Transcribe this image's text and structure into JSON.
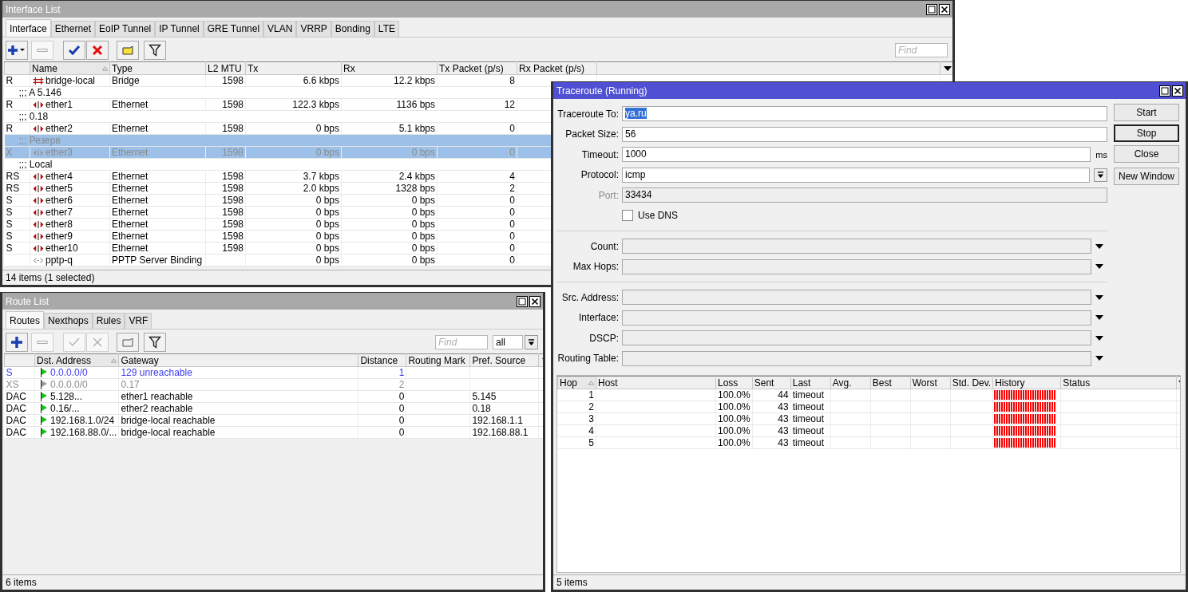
{
  "interface_window": {
    "title": "Interface List",
    "tabs": [
      {
        "label": "Interface",
        "selected": true
      },
      {
        "label": "Ethernet",
        "selected": false
      },
      {
        "label": "EoIP Tunnel",
        "selected": false
      },
      {
        "label": "IP Tunnel",
        "selected": false
      },
      {
        "label": "GRE Tunnel",
        "selected": false
      },
      {
        "label": "VLAN",
        "selected": false
      },
      {
        "label": "VRRP",
        "selected": false
      },
      {
        "label": "Bonding",
        "selected": false
      },
      {
        "label": "LTE",
        "selected": false
      }
    ],
    "toolbar": [
      {
        "kind": "add-menu",
        "disabled": false
      },
      {
        "kind": "remove",
        "disabled": true
      },
      {
        "kind": "enable",
        "disabled": false
      },
      {
        "kind": "disable",
        "disabled": false
      },
      {
        "kind": "comment",
        "disabled": false
      },
      {
        "kind": "filter",
        "disabled": false
      }
    ],
    "find": {
      "placeholder": "Find"
    },
    "columns": [
      {
        "sorted": false
      },
      {
        "label": "Name",
        "sorted": true
      },
      {
        "label": "Type",
        "sorted": false
      },
      {
        "label": "L2 MTU",
        "sorted": false
      },
      {
        "label": "Tx",
        "sorted": false
      },
      {
        "label": "Rx",
        "sorted": false
      },
      {
        "label": "Tx Packet (p/s)",
        "sorted": false
      },
      {
        "label": "Rx Packet (p/s)",
        "sorted": false
      }
    ],
    "rows": [
      {
        "kind": "bridge",
        "flags": "R",
        "name": "bridge-local",
        "type": "Bridge",
        "l2mtu": "1598",
        "tx": "6.6 kbps",
        "rx": "12.2 kbps",
        "tx_packet": "8",
        "selected": false,
        "disabled": false
      },
      {
        "kind": "comment",
        "text": ";;; A 5.146",
        "selected": false
      },
      {
        "kind": "ethernet",
        "flags": "R",
        "name": "ether1",
        "type": "Ethernet",
        "l2mtu": "1598",
        "tx": "122.3 kbps",
        "rx": "1136 bps",
        "tx_packet": "12",
        "selected": false,
        "disabled": false
      },
      {
        "kind": "comment",
        "text": ";;; 0.18",
        "selected": false
      },
      {
        "kind": "ethernet",
        "flags": "R",
        "name": "ether2",
        "type": "Ethernet",
        "l2mtu": "1598",
        "tx": "0 bps",
        "rx": "5.1 kbps",
        "tx_packet": "0",
        "selected": false,
        "disabled": false
      },
      {
        "kind": "comment",
        "text": ";;; Резерв",
        "selected": true
      },
      {
        "kind": "ethernet",
        "flags": "X",
        "name": "ether3",
        "type": "Ethernet",
        "l2mtu": "1598",
        "tx": "0 bps",
        "rx": "0 bps",
        "tx_packet": "0",
        "selected": true,
        "disabled": true
      },
      {
        "kind": "comment",
        "text": ";;; Local",
        "selected": false
      },
      {
        "kind": "ethernet",
        "flags": "RS",
        "name": "ether4",
        "type": "Ethernet",
        "l2mtu": "1598",
        "tx": "3.7 kbps",
        "rx": "2.4 kbps",
        "tx_packet": "4",
        "selected": false,
        "disabled": false
      },
      {
        "kind": "ethernet",
        "flags": "RS",
        "name": "ether5",
        "type": "Ethernet",
        "l2mtu": "1598",
        "tx": "2.0 kbps",
        "rx": "1328 bps",
        "tx_packet": "2",
        "selected": false,
        "disabled": false
      },
      {
        "kind": "ethernet",
        "flags": "S",
        "name": "ether6",
        "type": "Ethernet",
        "l2mtu": "1598",
        "tx": "0 bps",
        "rx": "0 bps",
        "tx_packet": "0",
        "selected": false,
        "disabled": false
      },
      {
        "kind": "ethernet",
        "flags": "S",
        "name": "ether7",
        "type": "Ethernet",
        "l2mtu": "1598",
        "tx": "0 bps",
        "rx": "0 bps",
        "tx_packet": "0",
        "selected": false,
        "disabled": false
      },
      {
        "kind": "ethernet",
        "flags": "S",
        "name": "ether8",
        "type": "Ethernet",
        "l2mtu": "1598",
        "tx": "0 bps",
        "rx": "0 bps",
        "tx_packet": "0",
        "selected": false,
        "disabled": false
      },
      {
        "kind": "ethernet",
        "flags": "S",
        "name": "ether9",
        "type": "Ethernet",
        "l2mtu": "1598",
        "tx": "0 bps",
        "rx": "0 bps",
        "tx_packet": "0",
        "selected": false,
        "disabled": false
      },
      {
        "kind": "ethernet",
        "flags": "S",
        "name": "ether10",
        "type": "Ethernet",
        "l2mtu": "1598",
        "tx": "0 bps",
        "rx": "0 bps",
        "tx_packet": "0",
        "selected": false,
        "disabled": false
      },
      {
        "kind": "binding",
        "name": "pptp-q",
        "type": "PPTP Server Binding",
        "tx": "0 bps",
        "rx": "0 bps",
        "tx_packet": "0",
        "selected": false,
        "disabled": false
      }
    ],
    "status": "14 items (1 selected)"
  },
  "route_window": {
    "title": "Route List",
    "tabs": [
      {
        "label": "Routes",
        "selected": true
      },
      {
        "label": "Nexthops",
        "selected": false
      },
      {
        "label": "Rules",
        "selected": false
      },
      {
        "label": "VRF",
        "selected": false
      }
    ],
    "toolbar": [
      {
        "kind": "add",
        "disabled": false
      },
      {
        "kind": "remove",
        "disabled": true
      },
      {
        "kind": "enable",
        "disabled": true
      },
      {
        "kind": "disable",
        "disabled": true
      },
      {
        "kind": "comment",
        "disabled": false
      },
      {
        "kind": "filter",
        "disabled": false
      }
    ],
    "find": {
      "placeholder": "Find"
    },
    "filter_value": "all",
    "columns": [
      {
        "sorted": false
      },
      {
        "label": "Dst. Address",
        "sorted": true
      },
      {
        "label": "Gateway",
        "sorted": false
      },
      {
        "label": "Distance",
        "sorted": false
      },
      {
        "label": "Routing Mark",
        "sorted": false
      },
      {
        "label": "Pref. Source",
        "sorted": false
      }
    ],
    "rows": [
      {
        "flags": "S",
        "dst": "0.0.0.0/0",
        "gateway": "129 unreachable",
        "distance": "1",
        "color": "#3c3cf0",
        "disabled": false
      },
      {
        "flags": "XS",
        "dst": "0.0.0.0/0",
        "gateway": "0.17",
        "distance": "2",
        "color": "#8a8a8a",
        "disabled": true
      },
      {
        "flags": "DAC",
        "dst": "5.128...",
        "gateway": "ether1 reachable",
        "distance": "0",
        "pref_source": "5.145",
        "color": "#000000",
        "disabled": false
      },
      {
        "flags": "DAC",
        "dst": "0.16/...",
        "gateway": "ether2 reachable",
        "distance": "0",
        "pref_source": "0.18",
        "color": "#000000",
        "disabled": false
      },
      {
        "flags": "DAC",
        "dst": "192.168.1.0/24",
        "gateway": "bridge-local reachable",
        "distance": "0",
        "pref_source": "192.168.1.1",
        "color": "#000000",
        "disabled": false
      },
      {
        "flags": "DAC",
        "dst": "192.168.88.0/...",
        "gateway": "bridge-local reachable",
        "distance": "0",
        "pref_source": "192.168.88.1",
        "color": "#000000",
        "disabled": false
      }
    ],
    "status": "6 items"
  },
  "traceroute_window": {
    "title": "Traceroute (Running)",
    "field_groups": [
      [
        {
          "kind": "text",
          "label": "Traceroute To:",
          "value": "ya.ru",
          "highlighted": true,
          "disabled": false
        },
        {
          "kind": "text",
          "label": "Packet Size:",
          "value": "56",
          "highlighted": false,
          "disabled": false
        },
        {
          "kind": "text",
          "label": "Timeout:",
          "value": "1000",
          "unit": "ms",
          "highlighted": false,
          "disabled": false
        },
        {
          "kind": "select",
          "label": "Protocol:",
          "value": "icmp"
        },
        {
          "kind": "text",
          "label": "Port:",
          "value": "33434",
          "highlighted": false,
          "disabled": true
        },
        {
          "kind": "checkbox",
          "label": "Use DNS",
          "checked": false
        }
      ],
      [
        {
          "kind": "combo",
          "label": "Count:"
        },
        {
          "kind": "combo",
          "label": "Max Hops:"
        }
      ],
      [
        {
          "kind": "combo",
          "label": "Src. Address:"
        },
        {
          "kind": "combo",
          "label": "Interface:"
        },
        {
          "kind": "combo",
          "label": "DSCP:"
        },
        {
          "kind": "combo",
          "label": "Routing Table:"
        }
      ]
    ],
    "button_groups": [
      [
        {
          "label": "Start",
          "default": false
        },
        {
          "label": "Stop",
          "default": true
        },
        {
          "label": "Close",
          "default": false
        }
      ],
      [
        {
          "label": "New Window",
          "default": false
        }
      ]
    ],
    "columns": [
      {
        "label": "Hop",
        "sorted": true
      },
      {
        "label": "Host",
        "sorted": false
      },
      {
        "label": "Loss",
        "sorted": false
      },
      {
        "label": "Sent",
        "sorted": false
      },
      {
        "label": "Last",
        "sorted": false
      },
      {
        "label": "Avg.",
        "sorted": false
      },
      {
        "label": "Best",
        "sorted": false
      },
      {
        "label": "Worst",
        "sorted": false
      },
      {
        "label": "Std. Dev.",
        "sorted": false
      },
      {
        "label": "History",
        "sorted": false
      },
      {
        "label": "Status",
        "sorted": false
      }
    ],
    "hops": [
      {
        "hop": "1",
        "loss": "100.0%",
        "sent": "44",
        "last": "timeout"
      },
      {
        "hop": "2",
        "loss": "100.0%",
        "sent": "43",
        "last": "timeout"
      },
      {
        "hop": "3",
        "loss": "100.0%",
        "sent": "43",
        "last": "timeout"
      },
      {
        "hop": "4",
        "loss": "100.0%",
        "sent": "43",
        "last": "timeout"
      },
      {
        "hop": "5",
        "loss": "100.0%",
        "sent": "43",
        "last": "timeout"
      }
    ],
    "status": "5 items"
  }
}
